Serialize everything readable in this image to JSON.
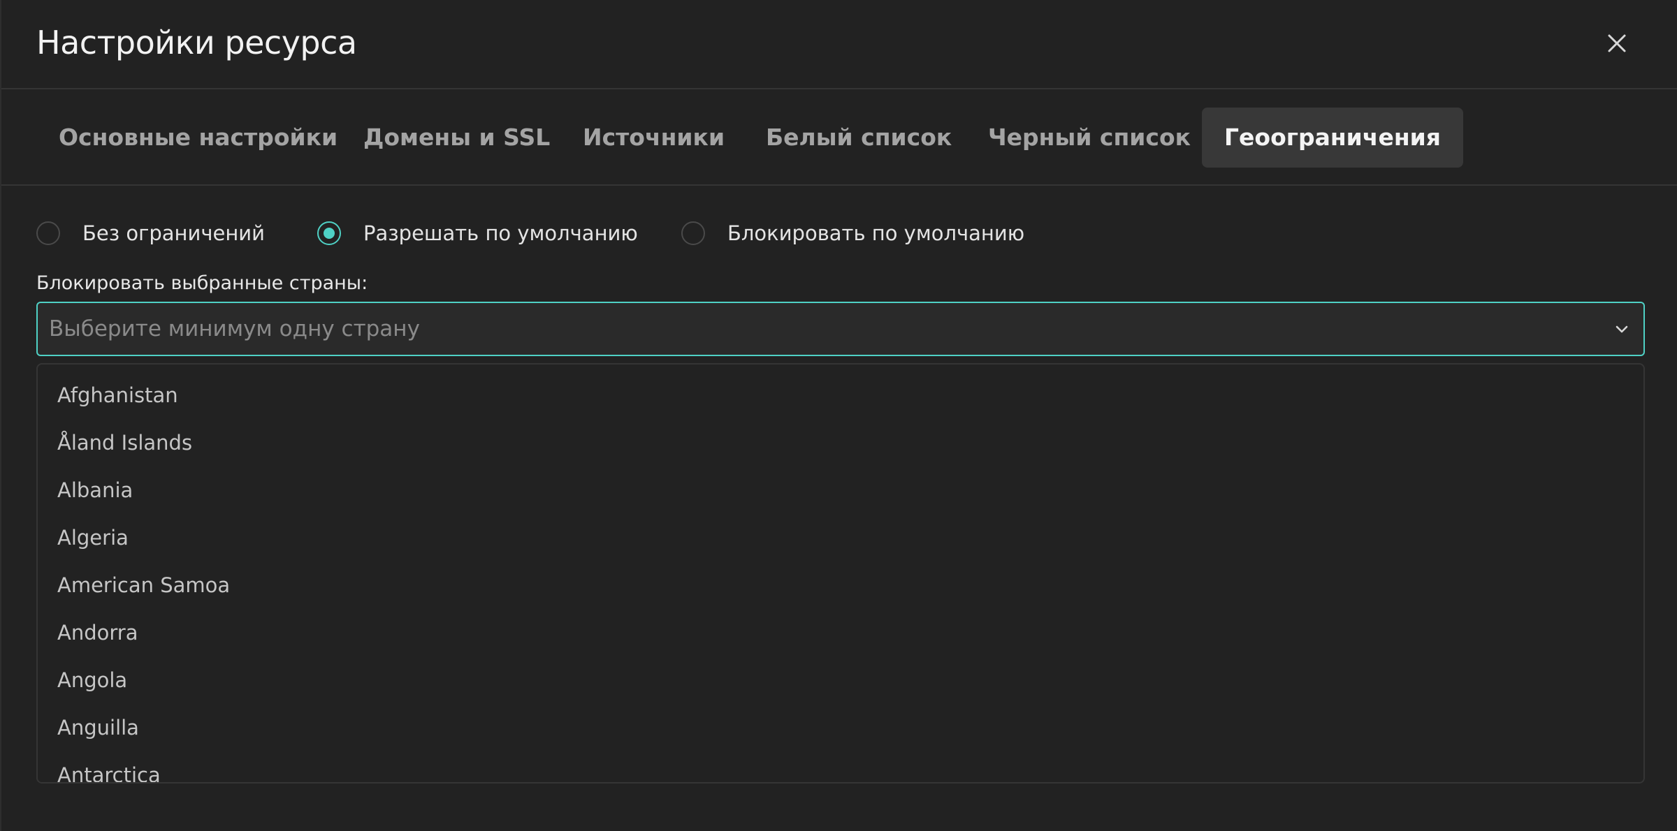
{
  "dialog": {
    "title": "Настройки ресурса"
  },
  "tabs": [
    {
      "label": "Основные настройки",
      "active": false
    },
    {
      "label": "Домены и SSL",
      "active": false
    },
    {
      "label": "Источники",
      "active": false
    },
    {
      "label": "Белый список",
      "active": false
    },
    {
      "label": "Черный список",
      "active": false
    },
    {
      "label": "Геоограничения",
      "active": true
    }
  ],
  "mode": {
    "options": [
      {
        "label": "Без ограничений",
        "checked": false
      },
      {
        "label": "Разрешать по умолчанию",
        "checked": true
      },
      {
        "label": "Блокировать по умолчанию",
        "checked": false
      }
    ]
  },
  "countries_field": {
    "label": "Блокировать выбранные страны:",
    "placeholder": "Выберите минимум одну страну",
    "options": [
      "Afghanistan",
      "Åland Islands",
      "Albania",
      "Algeria",
      "American Samoa",
      "Andorra",
      "Angola",
      "Anguilla",
      "Antarctica"
    ]
  },
  "colors": {
    "background": "#222222",
    "accent": "#4fd1c5",
    "active_tab_bg": "#383838",
    "muted_text": "#a4a4a4"
  },
  "icons": {
    "close": "close-icon",
    "chevron": "chevron-down-icon"
  }
}
